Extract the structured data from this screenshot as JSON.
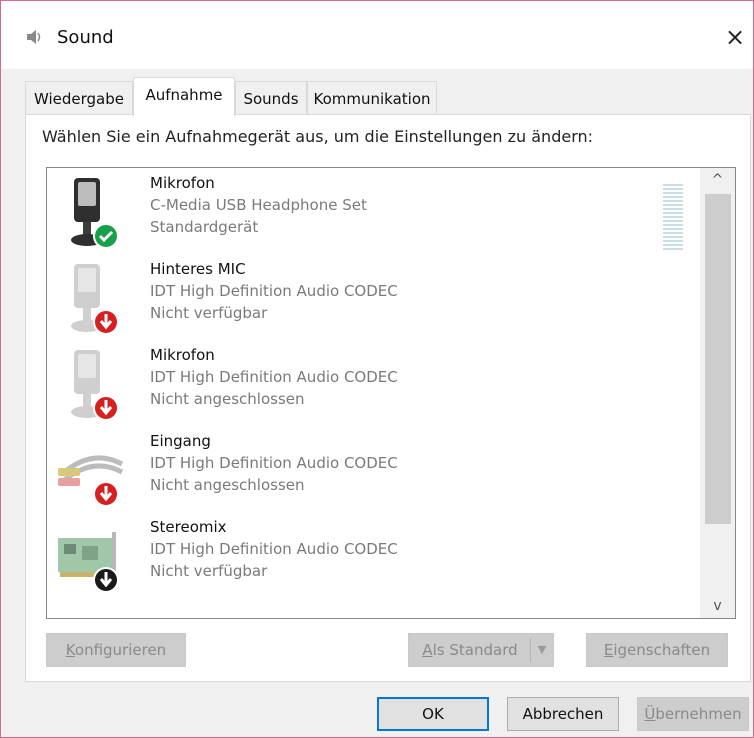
{
  "window": {
    "title": "Sound",
    "close_glyph": "×",
    "icon": "speaker-icon"
  },
  "tabs": [
    {
      "label": "Wiedergabe",
      "active": false
    },
    {
      "label": "Aufnahme",
      "active": true
    },
    {
      "label": "Sounds",
      "active": false
    },
    {
      "label": "Kommunikation",
      "active": false
    }
  ],
  "instruction": "Wählen Sie ein Aufnahmegerät aus, um die Einstellungen zu ändern:",
  "devices": [
    {
      "name": "Mikrofon",
      "description": "C-Media USB Headphone Set",
      "status": "Standardgerät",
      "icon": "microphone-icon",
      "badge": "check-badge-icon"
    },
    {
      "name": "Hinteres MIC",
      "description": "IDT High Definition Audio CODEC",
      "status": "Nicht verfügbar",
      "icon": "microphone-icon",
      "badge": "down-arrow-badge-icon"
    },
    {
      "name": "Mikrofon",
      "description": "IDT High Definition Audio CODEC",
      "status": "Nicht angeschlossen",
      "icon": "microphone-icon",
      "badge": "down-arrow-badge-icon"
    },
    {
      "name": "Eingang",
      "description": "IDT High Definition Audio CODEC",
      "status": "Nicht angeschlossen",
      "icon": "rca-cable-icon",
      "badge": "down-arrow-badge-icon"
    },
    {
      "name": "Stereomix",
      "description": "IDT High Definition Audio CODEC",
      "status": "Nicht verfügbar",
      "icon": "sound-card-icon",
      "badge": "down-arrow-badge-icon"
    }
  ],
  "scrollbar": {
    "up_glyph": "^",
    "down_glyph": "v"
  },
  "buttons": {
    "configure": {
      "accel": "K",
      "rest": "onfigurieren"
    },
    "set_default": {
      "accel": "A",
      "rest": "ls Standard",
      "dropdown_glyph": "▼"
    },
    "properties": {
      "accel": "E",
      "rest": "igenschaften"
    }
  },
  "footer": {
    "ok": "OK",
    "cancel": "Abbrechen",
    "apply": {
      "accel": "Ü",
      "rest": "bernehmen"
    }
  },
  "colors": {
    "accent": "#0078d7",
    "check_badge": "#15a04a",
    "arrow_badge": "#d61f1f",
    "window_border": "#d46a8c"
  }
}
